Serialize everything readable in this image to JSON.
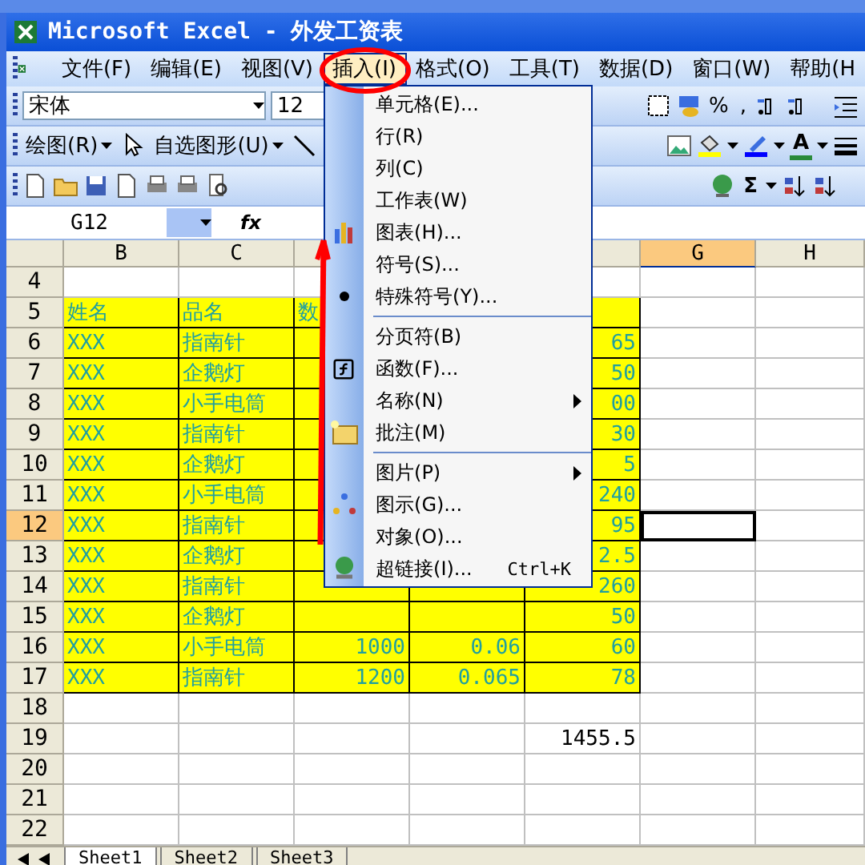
{
  "window": {
    "title": "Microsoft Excel - 外发工资表"
  },
  "menu_bar": [
    {
      "label": "文件(F)",
      "selected": false
    },
    {
      "label": "编辑(E)",
      "selected": false
    },
    {
      "label": "视图(V)",
      "selected": false
    },
    {
      "label": "插入(I)",
      "selected": true
    },
    {
      "label": "格式(O)",
      "selected": false
    },
    {
      "label": "工具(T)",
      "selected": false
    },
    {
      "label": "数据(D)",
      "selected": false
    },
    {
      "label": "窗口(W)",
      "selected": false
    },
    {
      "label": "帮助(H",
      "selected": false
    }
  ],
  "insert_menu": {
    "groups": [
      [
        {
          "label": "单元格(E)...",
          "submenu": false
        },
        {
          "label": "行(R)",
          "submenu": false
        },
        {
          "label": "列(C)",
          "submenu": false
        },
        {
          "label": "工作表(W)",
          "submenu": false
        },
        {
          "label": "图表(H)...",
          "submenu": false
        },
        {
          "label": "符号(S)...",
          "submenu": false
        },
        {
          "label": "特殊符号(Y)...",
          "submenu": false
        }
      ],
      [
        {
          "label": "分页符(B)",
          "submenu": false
        },
        {
          "label": "函数(F)...",
          "submenu": false
        },
        {
          "label": "名称(N)",
          "submenu": true
        },
        {
          "label": "批注(M)",
          "submenu": false
        }
      ],
      [
        {
          "label": "图片(P)",
          "submenu": true
        },
        {
          "label": "图示(G)...",
          "submenu": false
        },
        {
          "label": "对象(O)...",
          "submenu": false
        },
        {
          "label": "超链接(I)...",
          "submenu": false,
          "shortcut": "Ctrl+K"
        }
      ]
    ]
  },
  "format_toolbar": {
    "font": "宋体",
    "size": "12",
    "buttons": [
      "%",
      ","
    ]
  },
  "drawing_toolbar": {
    "draw_menu": "绘图(R)",
    "autoshapes_menu": "自选图形(U)",
    "font_color_label": "A"
  },
  "standard_toolbar": {
    "sum_label": "Σ"
  },
  "formula_bar": {
    "name_box": "G12",
    "fx_label": "fx"
  },
  "columns": [
    {
      "label": "B",
      "selected": false
    },
    {
      "label": "C",
      "selected": false
    },
    {},
    {},
    {},
    {
      "label": "G",
      "selected": true
    },
    {
      "label": "H",
      "selected": false
    }
  ],
  "rows": [
    {
      "number": "4",
      "kind": "blank",
      "selected": false,
      "cells": [
        null,
        null,
        null,
        null,
        null,
        null,
        null
      ]
    },
    {
      "number": "5",
      "kind": "header",
      "selected": false,
      "cells": [
        "姓名",
        "品名",
        "数",
        null,
        null,
        null,
        null
      ]
    },
    {
      "number": "6",
      "kind": "data",
      "selected": false,
      "cells": [
        "XXX",
        "指南针",
        null,
        null,
        "65",
        null,
        null
      ]
    },
    {
      "number": "7",
      "kind": "data",
      "selected": false,
      "cells": [
        "XXX",
        "企鹅灯",
        null,
        null,
        "50",
        null,
        null
      ]
    },
    {
      "number": "8",
      "kind": "data",
      "selected": false,
      "cells": [
        "XXX",
        "小手电筒",
        null,
        null,
        "00",
        null,
        null
      ]
    },
    {
      "number": "9",
      "kind": "data",
      "selected": false,
      "cells": [
        "XXX",
        "指南针",
        null,
        null,
        "30",
        null,
        null
      ]
    },
    {
      "number": "10",
      "kind": "data",
      "selected": false,
      "cells": [
        "XXX",
        "企鹅灯",
        null,
        null,
        "5",
        null,
        null
      ]
    },
    {
      "number": "11",
      "kind": "data",
      "selected": false,
      "cells": [
        "XXX",
        "小手电筒",
        null,
        null,
        "240",
        null,
        null
      ]
    },
    {
      "number": "12",
      "kind": "data",
      "selected": true,
      "cells": [
        "XXX",
        "指南针",
        null,
        null,
        "95",
        null,
        null
      ]
    },
    {
      "number": "13",
      "kind": "data",
      "selected": false,
      "cells": [
        "XXX",
        "企鹅灯",
        null,
        null,
        "2.5",
        null,
        null
      ]
    },
    {
      "number": "14",
      "kind": "data",
      "selected": false,
      "cells": [
        "XXX",
        "指南针",
        null,
        null,
        "260",
        null,
        null
      ]
    },
    {
      "number": "15",
      "kind": "data",
      "selected": false,
      "cells": [
        "XXX",
        "企鹅灯",
        null,
        null,
        "50",
        null,
        null
      ]
    },
    {
      "number": "16",
      "kind": "data",
      "selected": false,
      "cells": [
        "XXX",
        "小手电筒",
        "1000",
        "0.06",
        "60",
        null,
        null
      ]
    },
    {
      "number": "17",
      "kind": "data",
      "selected": false,
      "cells": [
        "XXX",
        "指南针",
        "1200",
        "0.065",
        "78",
        null,
        null
      ]
    },
    {
      "number": "18",
      "kind": "blank",
      "selected": false,
      "cells": [
        null,
        null,
        null,
        null,
        null,
        null,
        null
      ]
    },
    {
      "number": "19",
      "kind": "total",
      "selected": false,
      "cells": [
        null,
        null,
        null,
        null,
        "1455.5",
        null,
        null
      ]
    },
    {
      "number": "20",
      "kind": "blank",
      "selected": false,
      "cells": [
        null,
        null,
        null,
        null,
        null,
        null,
        null
      ]
    },
    {
      "number": "21",
      "kind": "blank",
      "selected": false,
      "cells": [
        null,
        null,
        null,
        null,
        null,
        null,
        null
      ]
    },
    {
      "number": "22",
      "kind": "blank",
      "selected": false,
      "cells": [
        null,
        null,
        null,
        null,
        null,
        null,
        null
      ]
    }
  ],
  "sheet_tabs": [
    {
      "label": "Sheet1",
      "selected": true
    },
    {
      "label": "Sheet2",
      "selected": false
    },
    {
      "label": "Sheet3",
      "selected": false
    }
  ]
}
